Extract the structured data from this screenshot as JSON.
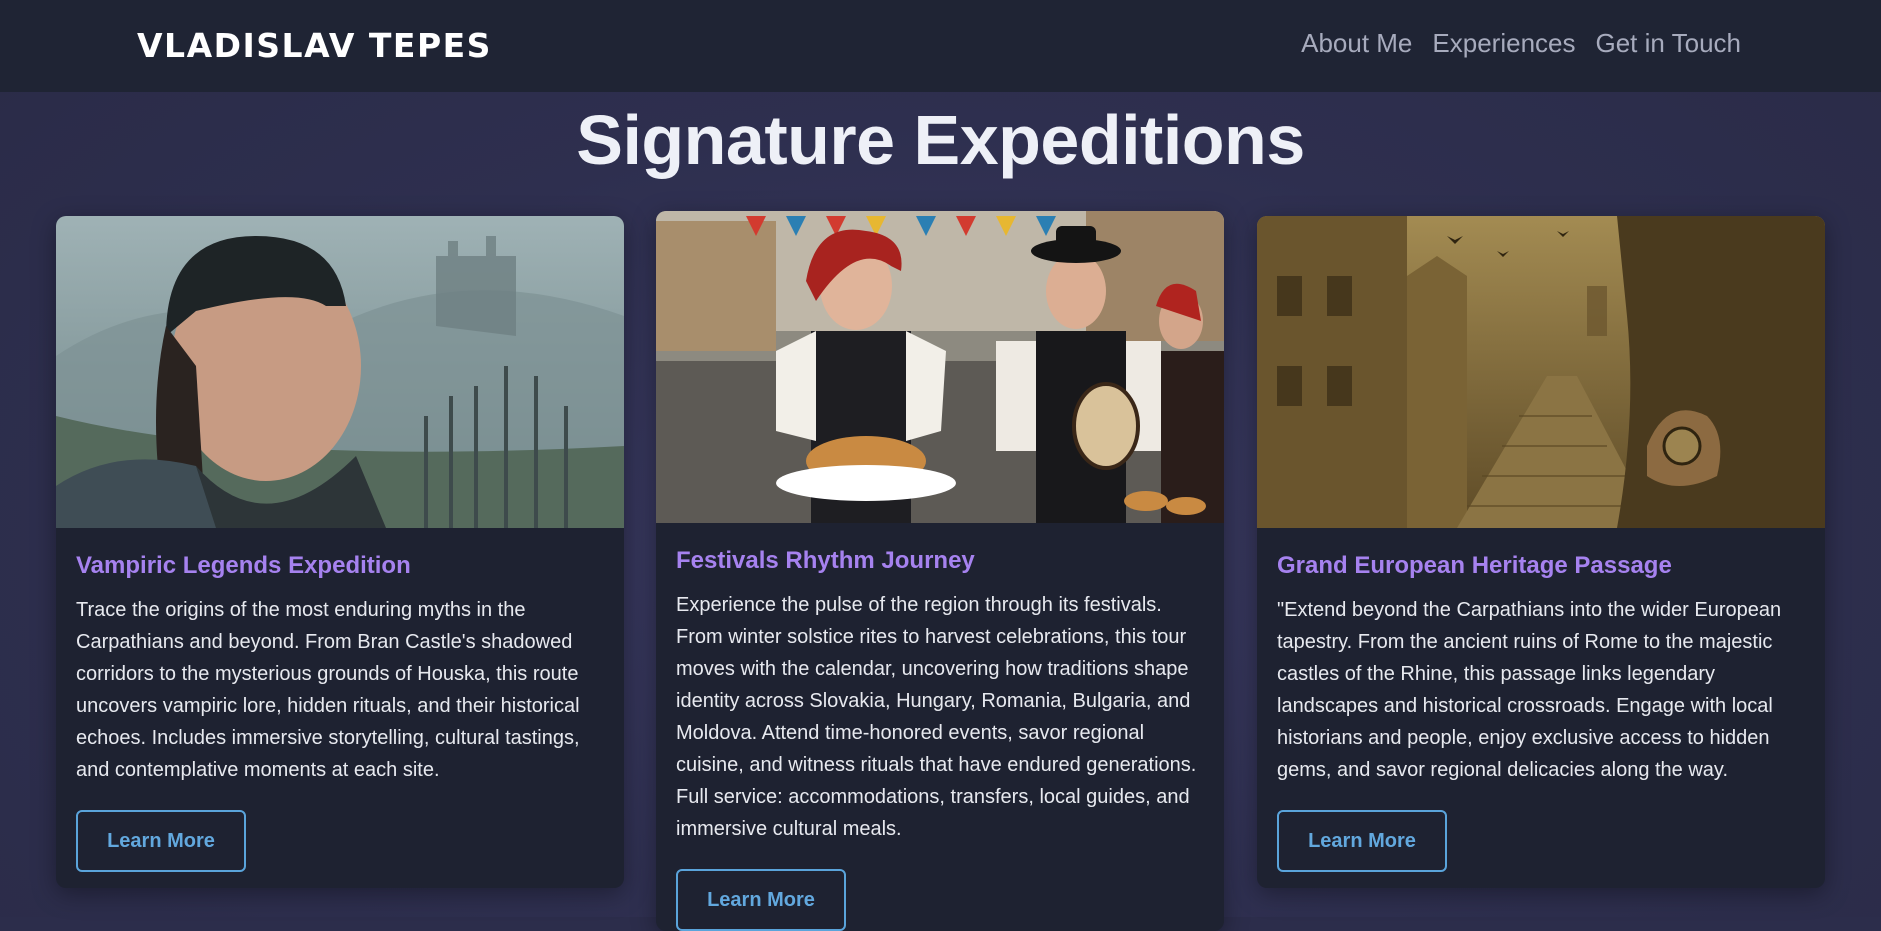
{
  "brand": "VLADISLAV TEPES",
  "nav": {
    "about": "About Me",
    "experiences": "Experiences",
    "contact": "Get in Touch"
  },
  "page_title": "Signature Expeditions",
  "cards": [
    {
      "title": "Vampiric Legends Expedition",
      "text": "Trace the origins of the most enduring myths in the Carpathians and beyond. From Bran Castle's shadowed corridors to the mysterious grounds of Houska, this route uncovers vampiric lore, hidden rituals, and their historical echoes. Includes immersive storytelling, cultural tastings, and contemplative moments at each site.",
      "button": "Learn More",
      "image": "misty-castle-portrait-photo"
    },
    {
      "title": "Festivals Rhythm Journey",
      "text": "Experience the pulse of the region through its festivals. From winter solstice rites to harvest celebrations, this tour moves with the calendar, uncovering how traditions shape identity across Slovakia, Hungary, Romania, Bulgaria, and Moldova. Attend time-honored events, savor regional cuisine, and witness rituals that have endured generations. Full service: accommodations, transfers, local guides, and immersive cultural meals.",
      "button": "Learn More",
      "image": "folk-festival-photo"
    },
    {
      "title": "Grand European Heritage Passage",
      "text": "\"Extend beyond the Carpathians into the wider European tapestry. From the ancient ruins of Rome to the majestic castles of the Rhine, this passage links legendary landscapes and historical crossroads. Engage with local historians and people, enjoy exclusive access to hidden gems, and savor regional delicacies along the way.",
      "button": "Learn More",
      "image": "sepia-old-town-compass-photo"
    }
  ],
  "colors": {
    "navbar_bg": "#1f2434",
    "page_bg": "#2e2f4f",
    "card_bg": "#1e2231",
    "card_title": "#a682ef",
    "button_accent": "#5aa4db"
  }
}
